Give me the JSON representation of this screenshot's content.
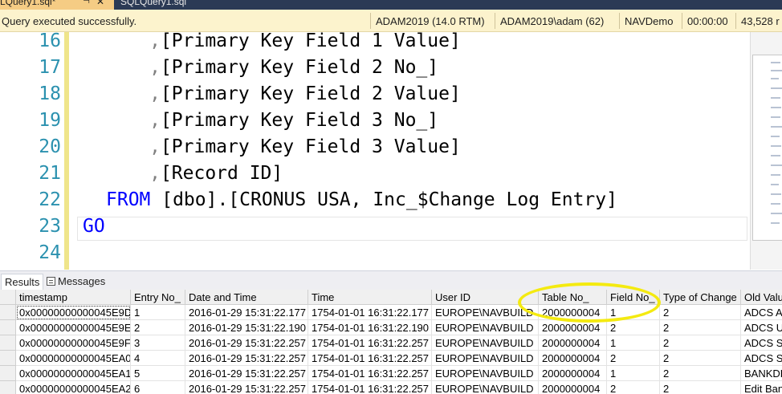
{
  "tabs": {
    "active_label": "LQuery1.sql*",
    "pin_glyph": "⊣",
    "close_glyph": "✕",
    "other_label": "SQLQuery1.sql"
  },
  "status": {
    "message": "Query executed successfully.",
    "server": "ADAM2019 (14.0 RTM)",
    "user": "ADAM2019\\adam (62)",
    "database": "NAVDemo",
    "elapsed": "00:00:00",
    "rows": "43,528 r"
  },
  "editor": {
    "lines": [
      {
        "num": "16",
        "pre": "      ,",
        "text": "[Primary Key Field 1 Value]"
      },
      {
        "num": "17",
        "pre": "      ,",
        "text": "[Primary Key Field 2 No_]"
      },
      {
        "num": "18",
        "pre": "      ,",
        "text": "[Primary Key Field 2 Value]"
      },
      {
        "num": "19",
        "pre": "      ,",
        "text": "[Primary Key Field 3 No_]"
      },
      {
        "num": "20",
        "pre": "      ,",
        "text": "[Primary Key Field 3 Value]"
      },
      {
        "num": "21",
        "pre": "      ,",
        "text": "[Record ID]"
      }
    ],
    "from_line": {
      "num": "22",
      "keyword": "FROM",
      "rest": " [dbo].[CRONUS USA, Inc_$Change Log Entry]"
    },
    "go_line": {
      "num": "23",
      "keyword": "GO"
    },
    "empty_line": {
      "num": "24"
    }
  },
  "result_tabs": {
    "results": "Results",
    "messages": "Messages"
  },
  "grid": {
    "columns": [
      "timestamp",
      "Entry No_",
      "Date and Time",
      "Time",
      "User ID",
      "Table No_",
      "Field No_",
      "Type of Change",
      "Old Value"
    ],
    "rows": [
      [
        "0x00000000000045E9D",
        "1",
        "2016-01-29 15:31:22.177",
        "1754-01-01 16:31:22.177",
        "EUROPE\\NAVBUILD",
        "2000000004",
        "1",
        "2",
        "ADCS A"
      ],
      [
        "0x00000000000045E9E",
        "2",
        "2016-01-29 15:31:22.190",
        "1754-01-01 16:31:22.190",
        "EUROPE\\NAVBUILD",
        "2000000004",
        "2",
        "2",
        "ADCS U"
      ],
      [
        "0x00000000000045E9F",
        "3",
        "2016-01-29 15:31:22.257",
        "1754-01-01 16:31:22.257",
        "EUROPE\\NAVBUILD",
        "2000000004",
        "1",
        "2",
        "ADCS S"
      ],
      [
        "0x00000000000045EA0",
        "4",
        "2016-01-29 15:31:22.257",
        "1754-01-01 16:31:22.257",
        "EUROPE\\NAVBUILD",
        "2000000004",
        "2",
        "2",
        "ADCS S"
      ],
      [
        "0x00000000000045EA1",
        "5",
        "2016-01-29 15:31:22.257",
        "1754-01-01 16:31:22.257",
        "EUROPE\\NAVBUILD",
        "2000000004",
        "1",
        "2",
        "BANKDE"
      ],
      [
        "0x00000000000045EA2",
        "6",
        "2016-01-29 15:31:22.257",
        "1754-01-01 16:31:22.257",
        "EUROPE\\NAVBUILD",
        "2000000004",
        "2",
        "2",
        "Edit Ban"
      ]
    ]
  },
  "colors": {
    "annotation": "#f4ea10",
    "keyword": "#0000ff",
    "line_number": "#2b91af"
  }
}
